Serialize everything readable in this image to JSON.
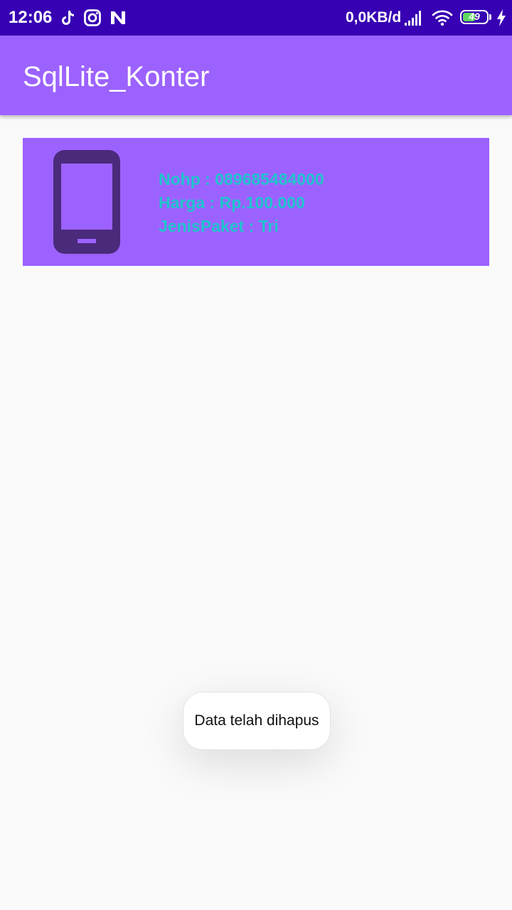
{
  "status_bar": {
    "time": "12:06",
    "network_speed": "0,0KB/d",
    "battery_level": "49",
    "icons": [
      "tiktok-icon",
      "instagram-icon",
      "n-app-icon",
      "signal-icon",
      "wifi-icon",
      "battery-icon",
      "charging-icon"
    ]
  },
  "app_bar": {
    "title": "SqlLite_Konter"
  },
  "list": {
    "items": [
      {
        "icon": "smartphone-icon",
        "nohp": "Nohp : 089685484000",
        "harga": "Harga : Rp.100.000",
        "jenis_paket": "JenisPaket : Tri"
      }
    ]
  },
  "toast": {
    "message": "Data telah dihapus"
  },
  "colors": {
    "status_bar": "#3700b3",
    "primary": "#9c62ff",
    "card_text": "#1fc4cc",
    "phone_icon": "#4a2a7a",
    "background": "#fafafa"
  }
}
